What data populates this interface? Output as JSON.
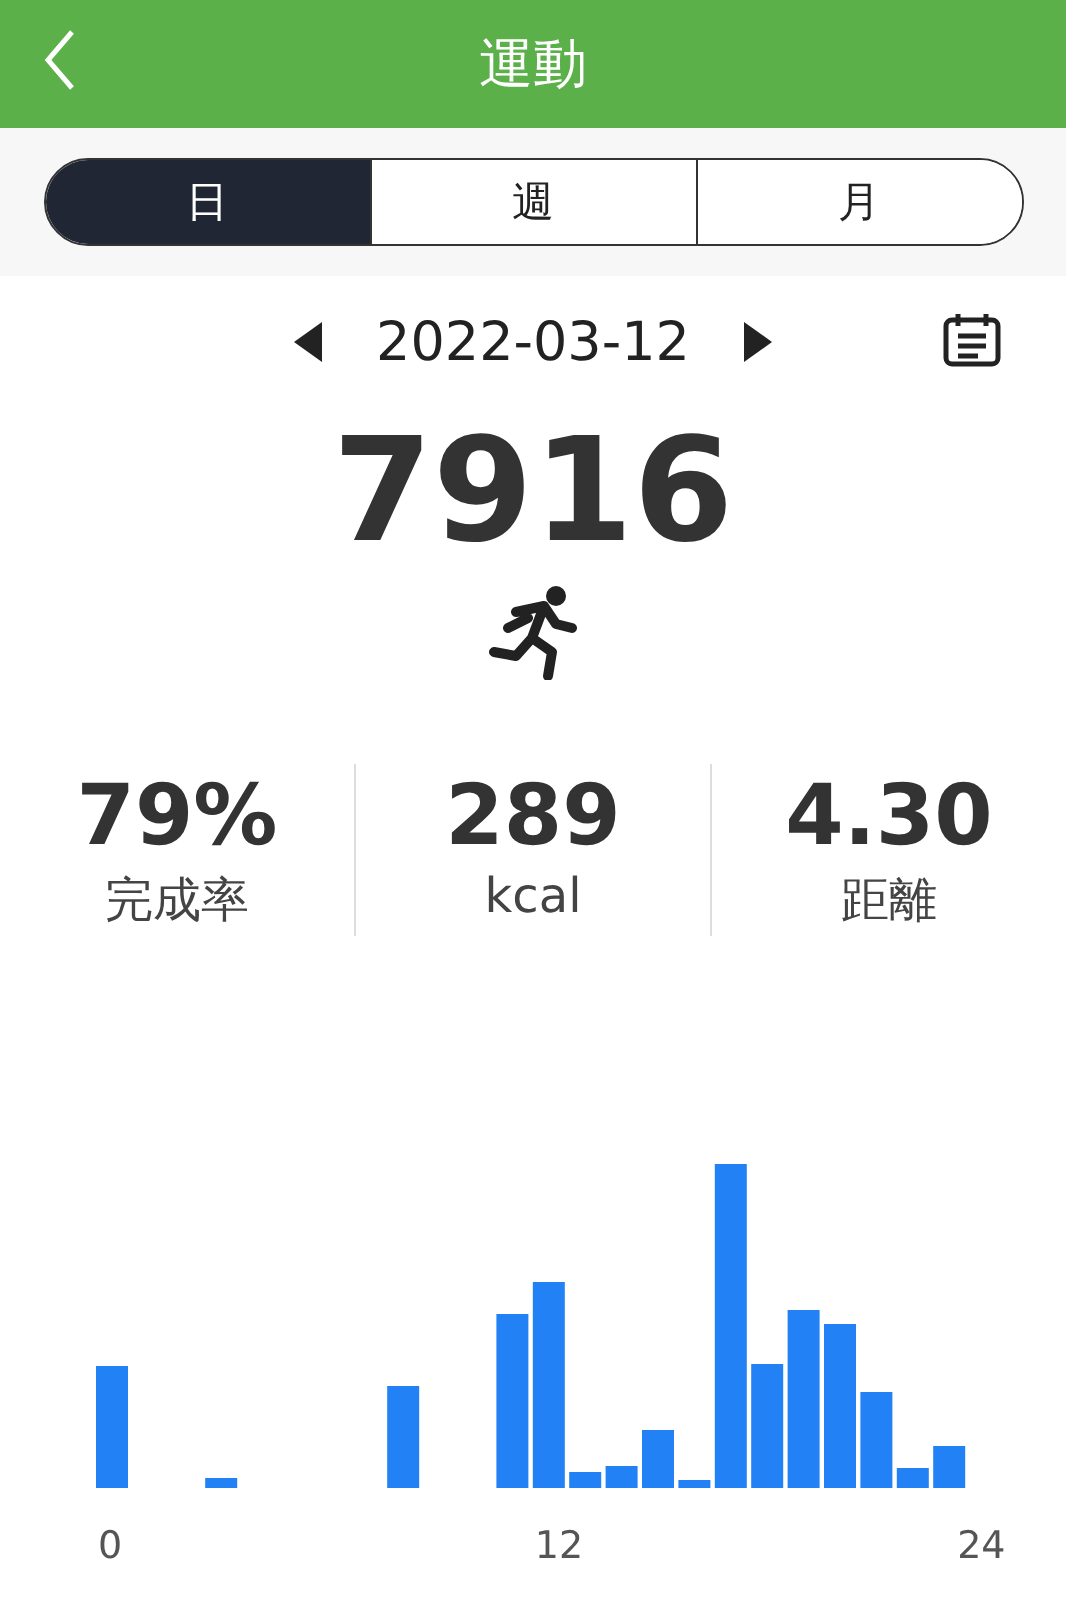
{
  "header": {
    "title": "運動"
  },
  "tabs": [
    {
      "label": "日",
      "selected": true
    },
    {
      "label": "週",
      "selected": false
    },
    {
      "label": "月",
      "selected": false
    }
  ],
  "date": "2022-03-12",
  "steps": "7916",
  "stats": [
    {
      "value": "79%",
      "label": "完成率"
    },
    {
      "value": "289",
      "label": "kcal"
    },
    {
      "value": "4.30",
      "label": "距離"
    }
  ],
  "chart": {
    "x_labels": [
      "0",
      "12",
      "24"
    ]
  }
}
